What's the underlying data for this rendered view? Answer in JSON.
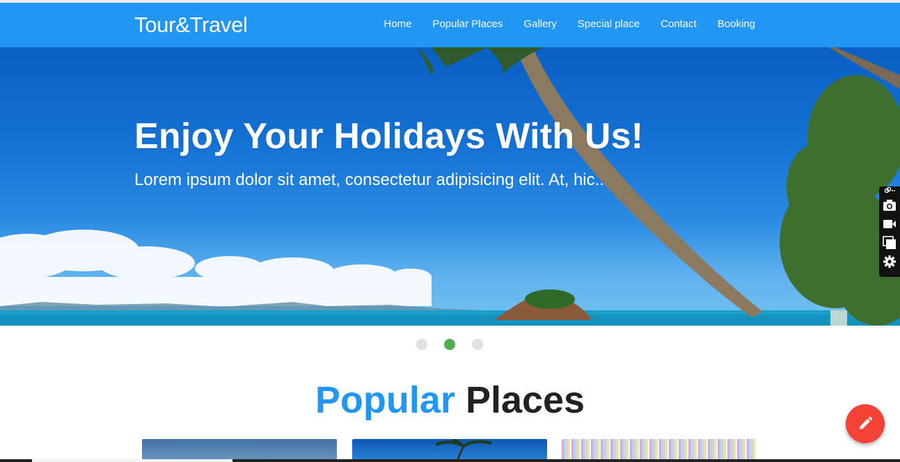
{
  "header": {
    "brand": "Tour&Travel",
    "nav": [
      "Home",
      "Popular Places",
      "Gallery",
      "Special place",
      "Contact",
      "Booking"
    ]
  },
  "hero": {
    "title": "Enjoy Your Holidays With Us!",
    "subtitle": "Lorem ipsum dolor sit amet, consectetur adipisicing elit. At, hic.."
  },
  "carousel": {
    "slides": 3,
    "active_index": 1
  },
  "section": {
    "title_accent": "Popular",
    "title_rest": "Places"
  },
  "side_tools": [
    "link-icon",
    "camera-icon",
    "video-icon",
    "windows-icon",
    "gear-icon"
  ],
  "fab": {
    "icon": "pencil-icon"
  },
  "colors": {
    "primary": "#2196f3",
    "active_dot": "#4caf50",
    "fab": "#f44336"
  }
}
